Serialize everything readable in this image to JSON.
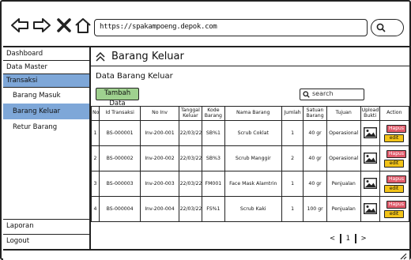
{
  "browser": {
    "url": "https://spakampoeng.depok.com"
  },
  "sidebar": {
    "items": [
      {
        "label": "Dashboard"
      },
      {
        "label": "Data Master"
      },
      {
        "label": "Transaksi"
      }
    ],
    "subitems": [
      {
        "label": "Barang Masuk"
      },
      {
        "label": "Barang Keluar"
      },
      {
        "label": "Retur Barang"
      }
    ],
    "bottom": [
      {
        "label": "Laporan"
      },
      {
        "label": "Logout"
      }
    ]
  },
  "main": {
    "page_title": "Barang Keluar",
    "section_title": "Data Barang Keluar",
    "add_button": "Tambah Data",
    "search_placeholder": "search"
  },
  "table": {
    "headers": [
      "No",
      "Id Transaksi",
      "No Inv",
      "Tanggal Keluar",
      "Kode Barang",
      "Nama Barang",
      "Jumlah",
      "Satuan Barang",
      "Tujuan",
      "Upload Bukti",
      "Action"
    ],
    "rows": [
      {
        "no": "1",
        "id": "BS-000001",
        "inv": "Inv-200-001",
        "tanggal": "22/03/22",
        "kode": "SB%1",
        "nama": "Scrub Coklat",
        "jumlah": "1",
        "satuan": "40 gr",
        "tujuan": "Operasional"
      },
      {
        "no": "2",
        "id": "BS-000002",
        "inv": "Inv-200-002",
        "tanggal": "22/03/22",
        "kode": "SB%3",
        "nama": "Scrub Manggir",
        "jumlah": "2",
        "satuan": "40 gr",
        "tujuan": "Operasional"
      },
      {
        "no": "3",
        "id": "BS-000003",
        "inv": "Inv-200-003",
        "tanggal": "22/03/22",
        "kode": "FM001",
        "nama": "Face Mask Alamtrin",
        "jumlah": "1",
        "satuan": "40 gr",
        "tujuan": "Penjualan"
      },
      {
        "no": "4",
        "id": "BS-000004",
        "inv": "Inv-200-004",
        "tanggal": "22/03/22",
        "kode": "FS%1",
        "nama": "Scrub Kaki",
        "jumlah": "1",
        "satuan": "100 gr",
        "tujuan": "Penjualan"
      }
    ],
    "hapus_label": "Hapus",
    "edit_label": "edit"
  },
  "pagination": {
    "prev": "<",
    "page": "1",
    "next": ">"
  },
  "colors": {
    "active_nav": "#7ea7d8",
    "add_button": "#9fd18f",
    "hapus": "#e05a6a",
    "edit": "#f2c318"
  }
}
